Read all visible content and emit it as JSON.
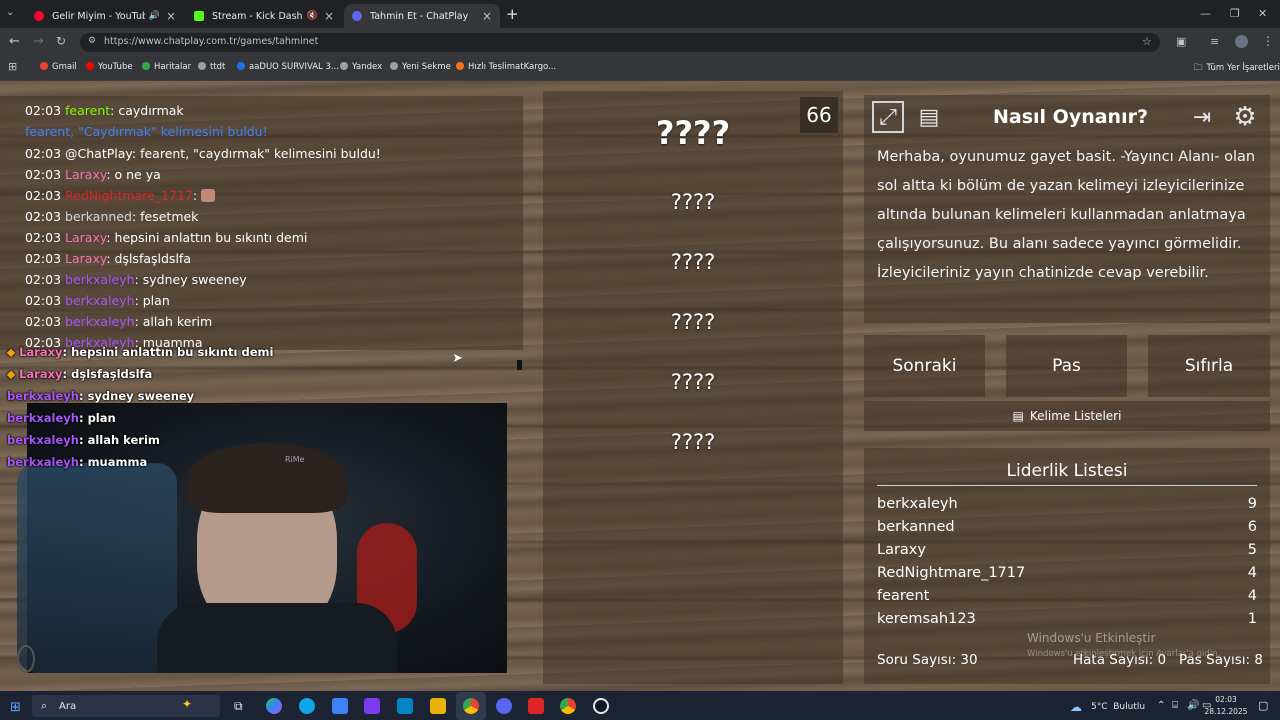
{
  "browser": {
    "tabs": [
      {
        "title": "Gelir Miyim - YouTube Music",
        "active": false,
        "icon": "youtube-music-icon"
      },
      {
        "title": "Stream - Kick Dashboard",
        "active": false,
        "icon": "kick-icon"
      },
      {
        "title": "Tahmin Et - ChatPlay",
        "active": true,
        "icon": "chatplay-icon"
      }
    ],
    "url": "https://www.chatplay.com.tr/games/tahminet",
    "bookmarks": [
      "Gmail",
      "YouTube",
      "Haritalar",
      "ttdt",
      "aaDUO SURVIVAL 3...",
      "Yandex",
      "Yeni Sekme",
      "Hızlı TeslimatKargo..."
    ],
    "all_bookmarks": "Tüm Yer İşaretleri"
  },
  "chat": {
    "messages": [
      {
        "time": "02:03",
        "user": "fearent",
        "user_color": "#7cfc00",
        "text": "caydırmak"
      },
      {
        "time": "",
        "user": "",
        "user_color": "#3b82f6",
        "text": "fearent, \"Caydırmak\" kelimesini buldu!"
      },
      {
        "time": "02:03",
        "user": "@ChatPlay",
        "user_color": "#ffffff",
        "text": "fearent, \"caydırmak\" kelimesini buldu!"
      },
      {
        "time": "02:03",
        "user": "Laraxy",
        "user_color": "#f472b6",
        "text": "o ne ya"
      },
      {
        "time": "02:03",
        "user": "RedNightmare_1717",
        "user_color": "#dc2626",
        "text": ""
      },
      {
        "time": "02:03",
        "user": "berkanned",
        "user_color": "#d1d5db",
        "text": "fesetmek"
      },
      {
        "time": "02:03",
        "user": "Laraxy",
        "user_color": "#f472b6",
        "text": "hepsini anlattın bu sıkıntı demi"
      },
      {
        "time": "02:03",
        "user": "Laraxy",
        "user_color": "#f472b6",
        "text": "dşlsfaşldslfa"
      },
      {
        "time": "02:03",
        "user": "berkxaleyh",
        "user_color": "#a855f7",
        "text": "sydney sweeney"
      },
      {
        "time": "02:03",
        "user": "berkxaleyh",
        "user_color": "#a855f7",
        "text": "plan"
      },
      {
        "time": "02:03",
        "user": "berkxaleyh",
        "user_color": "#a855f7",
        "text": "allah kerim"
      },
      {
        "time": "02:03",
        "user": "berkxaleyh",
        "user_color": "#a855f7",
        "text": "muamma"
      }
    ],
    "overlay": [
      {
        "user": "Laraxy",
        "text": ": hepsini anlattın bu sıkıntı demi"
      },
      {
        "user": "Laraxy",
        "text": ": dşlsfaşldslfa"
      },
      {
        "user": "berkxaleyh",
        "text": ": sydney sweeney"
      },
      {
        "user": "berkxaleyh",
        "text": ": plan"
      },
      {
        "user": "berkxaleyh",
        "text": ": allah kerim"
      },
      {
        "user": "berkxaleyh",
        "text": ": muamma"
      }
    ]
  },
  "game": {
    "timer": "66",
    "main_word": "????",
    "taboo_words": [
      "????",
      "????",
      "????",
      "????",
      "????"
    ]
  },
  "howto": {
    "title": "Nasıl Oynanır?",
    "body": "Merhaba, oyunumuz gayet basit. -Yayıncı Alanı- olan sol altta ki bölüm de yazan kelimeyi izleyicilerinize altında bulunan kelimeleri kullanmadan anlatmaya çalışıyorsunuz. Bu alanı sadece yayıncı görmelidir. İzleyicileriniz yayın chatinizde cevap verebilir."
  },
  "buttons": {
    "next": "Sonraki",
    "pass": "Pas",
    "reset": "Sıfırla",
    "word_lists": "Kelime Listeleri"
  },
  "leaderboard": {
    "title": "Liderlik Listesi",
    "rows": [
      {
        "name": "berkxaleyh",
        "score": "9"
      },
      {
        "name": "berkanned",
        "score": "6"
      },
      {
        "name": "Laraxy",
        "score": "5"
      },
      {
        "name": "RedNightmare_1717",
        "score": "4"
      },
      {
        "name": "fearent",
        "score": "4"
      },
      {
        "name": "keremsah123",
        "score": "1"
      }
    ],
    "question_count": "Soru Sayısı: 30",
    "error_count": "Hata Sayısı: 0",
    "pass_count": "Pas Sayısı: 8"
  },
  "watermark": {
    "line1": "Windows'u Etkinleştir",
    "line2": "Windows'u etkinleştirmek için Ayarlar'a gidin."
  },
  "taskbar": {
    "search": "Ara",
    "weather": "5°C  Bulutlu",
    "time": "02:03",
    "date": "28.12.2025"
  }
}
